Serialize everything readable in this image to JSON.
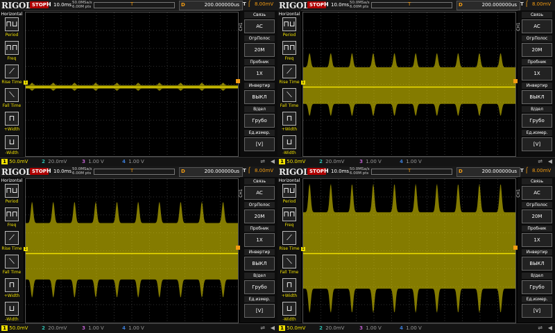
{
  "colors": {
    "ch1": "#f0e000",
    "ch2": "#2ec4b6",
    "ch3": "#c060d0",
    "ch4": "#3a7bd5",
    "trigger": "#f39c12",
    "stop_bg": "#b00000"
  },
  "header": {
    "logo": "RIGOL",
    "status": "STOP",
    "h_label": "H",
    "timebase": "10.0ms",
    "sample_rate": "50.0MSa/s",
    "mem_depth": "6.00M pts",
    "delay_label": "D",
    "delay_value": "200.000000us",
    "trigger_label": "T",
    "trigger_slope_icon": "rising-edge-icon",
    "trigger_value": "8.00mV"
  },
  "left_menu": {
    "title": "Horizontal",
    "items": [
      {
        "icon": "period-icon",
        "label": "Period"
      },
      {
        "icon": "freq-icon",
        "label": "Freq"
      },
      {
        "icon": "rise-time-icon",
        "label": "Rise Time"
      },
      {
        "icon": "fall-time-icon",
        "label": "Fall Time"
      },
      {
        "icon": "plus-width-icon",
        "label": "+Width"
      },
      {
        "icon": "minus-width-icon",
        "label": "-Width"
      }
    ]
  },
  "right_menu": {
    "channel": "CH1",
    "items": [
      {
        "label": "Связь",
        "value": "AC"
      },
      {
        "label": "ОгрПолос",
        "value": "20M"
      },
      {
        "label": "Пробник",
        "value": "1X"
      },
      {
        "label": "Инвертир",
        "value": "ВЫКЛ"
      },
      {
        "label": "В/дел",
        "value": "Грубо"
      },
      {
        "label": "Ед.измер.",
        "value": "[V]"
      }
    ]
  },
  "footer": {
    "ch1": {
      "num": "1",
      "scale": "50.0mV"
    },
    "ch2": {
      "num": "2",
      "scale": "20.0mV"
    },
    "ch3": {
      "num": "3",
      "scale": "1.00 V"
    },
    "ch4": {
      "num": "4",
      "scale": "1.00 V"
    }
  },
  "panels": [
    {
      "id": "top-left",
      "waveform": {
        "period_divs": 0.8,
        "envelope_low": 0.05,
        "envelope_high": 0.12,
        "center": 0.0
      }
    },
    {
      "id": "top-right",
      "waveform": {
        "period_divs": 0.8,
        "envelope_low": 0.55,
        "envelope_high": 0.95,
        "center": 0.0
      }
    },
    {
      "id": "bottom-left",
      "waveform": {
        "period_divs": 0.8,
        "envelope_low": 0.85,
        "envelope_high": 1.45,
        "center": 0.0
      }
    },
    {
      "id": "bottom-right",
      "waveform": {
        "period_divs": 0.8,
        "envelope_low": 1.15,
        "envelope_high": 1.95,
        "center": 0.0
      }
    }
  ]
}
